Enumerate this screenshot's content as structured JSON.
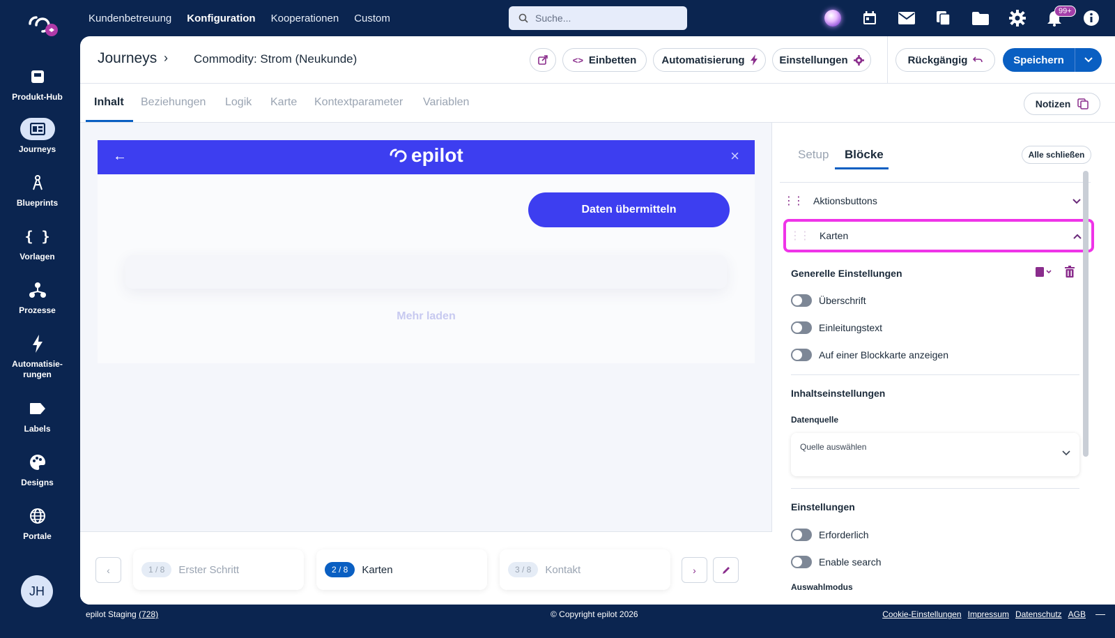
{
  "topnav": {
    "items": [
      "Kundenbetreuung",
      "Konfiguration",
      "Kooperationen",
      "Custom"
    ],
    "active": "Konfiguration"
  },
  "search": {
    "placeholder": "Suche..."
  },
  "notifications": {
    "badge": "99+"
  },
  "sidebar": {
    "items": [
      {
        "label": "Produkt-Hub",
        "icon": "product-hub-icon"
      },
      {
        "label": "Journeys",
        "icon": "journeys-icon",
        "active": true
      },
      {
        "label": "Blueprints",
        "icon": "blueprints-icon"
      },
      {
        "label": "Vorlagen",
        "icon": "braces-icon"
      },
      {
        "label": "Prozesse",
        "icon": "processes-icon"
      },
      {
        "label": "Automatisie-rungen",
        "icon": "lightning-icon"
      },
      {
        "label": "Labels",
        "icon": "label-icon"
      },
      {
        "label": "Designs",
        "icon": "palette-icon"
      },
      {
        "label": "Portale",
        "icon": "globe-icon"
      }
    ],
    "avatar": "JH"
  },
  "header": {
    "breadcrumb_root": "Journeys",
    "page_title": "Commodity: Strom (Neukunde)",
    "embed_label": "Einbetten",
    "automation_label": "Automatisierung",
    "settings_label": "Einstellungen",
    "undo_label": "Rückgängig",
    "save_label": "Speichern"
  },
  "tabs": {
    "items": [
      "Inhalt",
      "Beziehungen",
      "Logik",
      "Karte",
      "Kontextparameter",
      "Variablen"
    ],
    "active": "Inhalt",
    "notes_label": "Notizen"
  },
  "preview": {
    "brand": "epilot",
    "submit_label": "Daten übermitteln",
    "more_label": "Mehr laden",
    "accent_color": "#3d3ef0"
  },
  "steps": {
    "items": [
      {
        "num": "1 / 8",
        "label": "Erster Schritt"
      },
      {
        "num": "2 / 8",
        "label": "Karten",
        "active": true
      },
      {
        "num": "3 / 8",
        "label": "Kontakt"
      }
    ]
  },
  "panel": {
    "tabs": [
      "Setup",
      "Blöcke"
    ],
    "active_tab": "Blöcke",
    "close_all_label": "Alle schließen",
    "blocks": [
      {
        "label": "Aktionsbuttons",
        "expanded": false
      },
      {
        "label": "Karten",
        "expanded": true,
        "highlighted": true
      }
    ],
    "general_title": "Generelle Einstellungen",
    "general_toggles": [
      "Überschrift",
      "Einleitungstext",
      "Auf einer Blockkarte anzeigen"
    ],
    "content_title": "Inhaltseinstellungen",
    "datasource_label": "Datenquelle",
    "datasource_placeholder": "Quelle auswählen",
    "settings_title": "Einstellungen",
    "settings_toggles": [
      "Erforderlich",
      "Enable search"
    ],
    "selection_mode_label": "Auswahlmodus"
  },
  "footer": {
    "env_label": "epilot Staging",
    "env_id": "(728)",
    "copyright": "© Copyright epilot 2026",
    "links": [
      "Cookie-Einstellungen",
      "Impressum",
      "Datenschutz",
      "AGB"
    ]
  }
}
